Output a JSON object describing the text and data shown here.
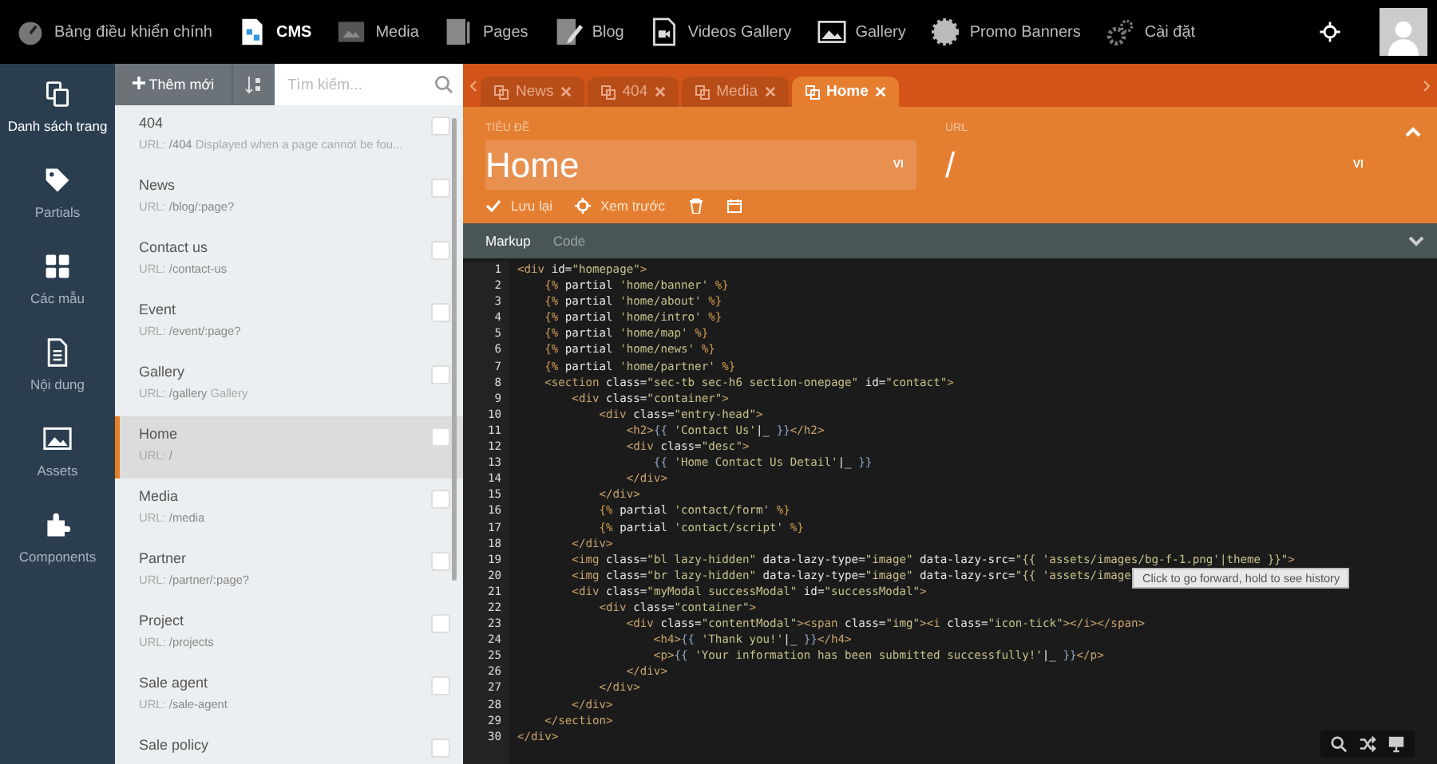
{
  "top_nav": [
    {
      "label": "Bảng điều khiển chính",
      "selected": false
    },
    {
      "label": "CMS",
      "selected": true
    },
    {
      "label": "Media",
      "selected": false
    },
    {
      "label": "Pages",
      "selected": false
    },
    {
      "label": "Blog",
      "selected": false
    },
    {
      "label": "Videos Gallery",
      "selected": false
    },
    {
      "label": "Gallery",
      "selected": false
    },
    {
      "label": "Promo Banners",
      "selected": false
    },
    {
      "label": "Cài đặt",
      "selected": false
    }
  ],
  "sidebar": {
    "items": [
      {
        "label": "Danh sách trang",
        "selected": true
      },
      {
        "label": "Partials",
        "selected": false
      },
      {
        "label": "Các mẫu",
        "selected": false
      },
      {
        "label": "Nội dung",
        "selected": false
      },
      {
        "label": "Assets",
        "selected": false
      },
      {
        "label": "Components",
        "selected": false
      }
    ]
  },
  "list_toolbar": {
    "add_button": "Thêm mới",
    "search": {
      "placeholder": "Tìm kiếm..."
    }
  },
  "pages": [
    {
      "title": "404",
      "url_label": "URL:",
      "url": "/404",
      "description": "Displayed when a page cannot be fou...",
      "selected": false,
      "checked": false
    },
    {
      "title": "News",
      "url_label": "URL:",
      "url": "/blog/:page?",
      "selected": false,
      "checked": false
    },
    {
      "title": "Contact us",
      "url_label": "URL:",
      "url": "/contact-us",
      "selected": false,
      "checked": false
    },
    {
      "title": "Event",
      "url_label": "URL:",
      "url": "/event/:page?",
      "selected": false,
      "checked": false
    },
    {
      "title": "Gallery",
      "url_label": "URL:",
      "url": "/gallery",
      "description": "Gallery",
      "selected": false,
      "checked": false
    },
    {
      "title": "Home",
      "url_label": "URL:",
      "url": "/",
      "selected": true,
      "checked": false
    },
    {
      "title": "Media",
      "url_label": "URL:",
      "url": "/media",
      "selected": false,
      "checked": false
    },
    {
      "title": "Partner",
      "url_label": "URL:",
      "url": "/partner/:page?",
      "selected": false,
      "checked": false
    },
    {
      "title": "Project",
      "url_label": "URL:",
      "url": "/projects",
      "selected": false,
      "checked": false
    },
    {
      "title": "Sale agent",
      "url_label": "URL:",
      "url": "/sale-agent",
      "selected": false,
      "checked": false
    },
    {
      "title": "Sale policy",
      "selected": false,
      "checked": false
    }
  ],
  "editor_tabs": [
    {
      "label": "News",
      "selected": false
    },
    {
      "label": "404",
      "selected": false
    },
    {
      "label": "Media",
      "selected": false
    },
    {
      "label": "Home",
      "selected": true
    }
  ],
  "form": {
    "title_field": {
      "label": "TIÊU ĐỀ",
      "value": "Home",
      "locale": "VI"
    },
    "url_field": {
      "label": "URL",
      "value": "/",
      "locale": "VI"
    },
    "actions": [
      "Lưu lại",
      "Xem trước"
    ]
  },
  "code_tabs": [
    {
      "label": "Markup",
      "selected": true
    },
    {
      "label": "Code",
      "selected": false
    }
  ],
  "code_lines": [
    {
      "number": "1",
      "text": "<div id=\"homepage\">"
    },
    {
      "number": "2",
      "text": "    {% partial 'home/banner' %}"
    },
    {
      "number": "3",
      "text": "    {% partial 'home/about' %}"
    },
    {
      "number": "4",
      "text": "    {% partial 'home/intro' %}"
    },
    {
      "number": "5",
      "text": "    {% partial 'home/map' %}"
    },
    {
      "number": "6",
      "text": "    {% partial 'home/news' %}"
    },
    {
      "number": "7",
      "text": "    {% partial 'home/partner' %}"
    },
    {
      "number": "8",
      "text": "    <section class=\"sec-tb sec-h6 section-onepage\" id=\"contact\">"
    },
    {
      "number": "9",
      "text": "        <div class=\"container\">"
    },
    {
      "number": "10",
      "text": "            <div class=\"entry-head\">"
    },
    {
      "number": "11",
      "text": "                <h2>{{ 'Contact Us'|_ }}</h2>"
    },
    {
      "number": "12",
      "text": "                <div class=\"desc\">"
    },
    {
      "number": "13",
      "text": "                    {{ 'Home Contact Us Detail'|_ }}"
    },
    {
      "number": "14",
      "text": "                </div>"
    },
    {
      "number": "15",
      "text": "            </div>"
    },
    {
      "number": "16",
      "text": "            {% partial 'contact/form' %}"
    },
    {
      "number": "17",
      "text": "            {% partial 'contact/script' %}"
    },
    {
      "number": "18",
      "text": "        </div>"
    },
    {
      "number": "19",
      "text": "        <img class=\"bl lazy-hidden\" data-lazy-type=\"image\" data-lazy-src=\"{{ 'assets/images/bg-f-1.png'|theme }}\">"
    },
    {
      "number": "20",
      "text": "        <img class=\"br lazy-hidden\" data-lazy-type=\"image\" data-lazy-src=\"{{ 'assets/image",
      "tooltip": "Click to go forward, hold to see history"
    },
    {
      "number": "21",
      "text": "        <div class=\"myModal successModal\" id=\"successModal\">"
    },
    {
      "number": "22",
      "text": "            <div class=\"container\">"
    },
    {
      "number": "23",
      "text": "                <div class=\"contentModal\"><span class=\"img\"><i class=\"icon-tick\"></i></span>"
    },
    {
      "number": "24",
      "text": "                    <h4>{{ 'Thank you!'|_ }}</h4>"
    },
    {
      "number": "25",
      "text": "                    <p>{{ 'Your information has been submitted successfully!'|_ }}</p>"
    },
    {
      "number": "26",
      "text": "                </div>"
    },
    {
      "number": "27",
      "text": "            </div>"
    },
    {
      "number": "28",
      "text": "        </div>"
    },
    {
      "number": "29",
      "text": "    </section>"
    },
    {
      "number": "30",
      "text": "</div>"
    }
  ]
}
